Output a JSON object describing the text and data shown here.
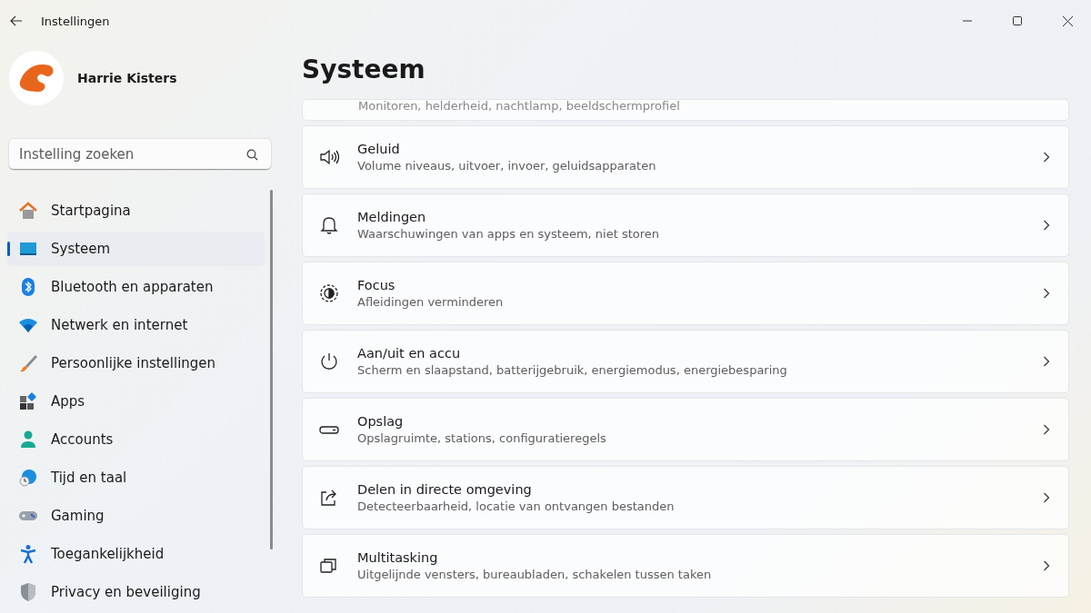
{
  "window": {
    "title": "Instellingen"
  },
  "profile": {
    "name": "Harrie Kisters"
  },
  "search": {
    "placeholder": "Instelling zoeken"
  },
  "nav": [
    {
      "label": "Startpagina",
      "selected": false
    },
    {
      "label": "Systeem",
      "selected": true
    },
    {
      "label": "Bluetooth en apparaten",
      "selected": false
    },
    {
      "label": "Netwerk en internet",
      "selected": false
    },
    {
      "label": "Persoonlijke instellingen",
      "selected": false
    },
    {
      "label": "Apps",
      "selected": false
    },
    {
      "label": "Accounts",
      "selected": false
    },
    {
      "label": "Tijd en taal",
      "selected": false
    },
    {
      "label": "Gaming",
      "selected": false
    },
    {
      "label": "Toegankelijkheid",
      "selected": false
    },
    {
      "label": "Privacy en beveiliging",
      "selected": false
    }
  ],
  "page": {
    "title": "Systeem"
  },
  "partial_card": {
    "subtitle": "Monitoren, helderheid, nachtlamp, beeldschermprofiel"
  },
  "cards": [
    {
      "title": "Geluid",
      "subtitle": "Volume niveaus, uitvoer, invoer, geluidsapparaten"
    },
    {
      "title": "Meldingen",
      "subtitle": "Waarschuwingen van apps en systeem, niet storen"
    },
    {
      "title": "Focus",
      "subtitle": "Afleidingen verminderen"
    },
    {
      "title": "Aan/uit en accu",
      "subtitle": "Scherm en slaapstand, batterijgebruik, energiemodus, energiebesparing"
    },
    {
      "title": "Opslag",
      "subtitle": "Opslagruimte, stations, configuratieregels"
    },
    {
      "title": "Delen in directe omgeving",
      "subtitle": "Detecteerbaarheid, locatie van ontvangen bestanden"
    },
    {
      "title": "Multitasking",
      "subtitle": "Uitgelijnde vensters, bureaubladen, schakelen tussen taken"
    }
  ]
}
